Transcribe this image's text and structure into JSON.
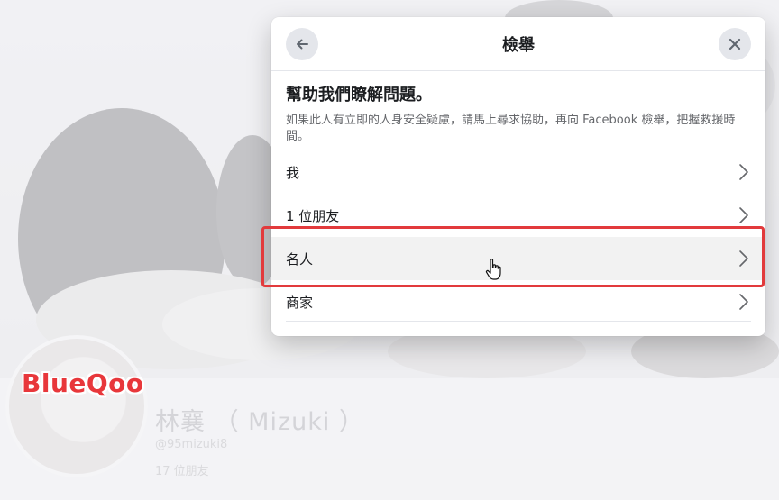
{
  "background": {
    "profile_name": "林襄 （ Mizuki ）",
    "profile_handle": "@95mizuki8",
    "profile_friends": "17 位朋友"
  },
  "watermark": "BlueQoo",
  "dialog": {
    "title": "檢舉",
    "heading": "幫助我們瞭解問題。",
    "description": "如果此人有立即的人身安全疑慮，請馬上尋求協助，再向 Facebook 檢舉，把握救援時間。",
    "options": [
      {
        "label": "我"
      },
      {
        "label": "1 位朋友"
      },
      {
        "label": "名人"
      },
      {
        "label": "商家"
      }
    ],
    "hovered_option": "名人"
  },
  "colors": {
    "highlight": "#e23a3c",
    "watermark": "#e8373b",
    "icon_button_bg": "#e4e6eb"
  },
  "icons": {
    "back": "left-arrow-icon",
    "close": "close-icon",
    "chevron": "chevron-right-icon",
    "cursor": "hand-pointer-icon"
  }
}
